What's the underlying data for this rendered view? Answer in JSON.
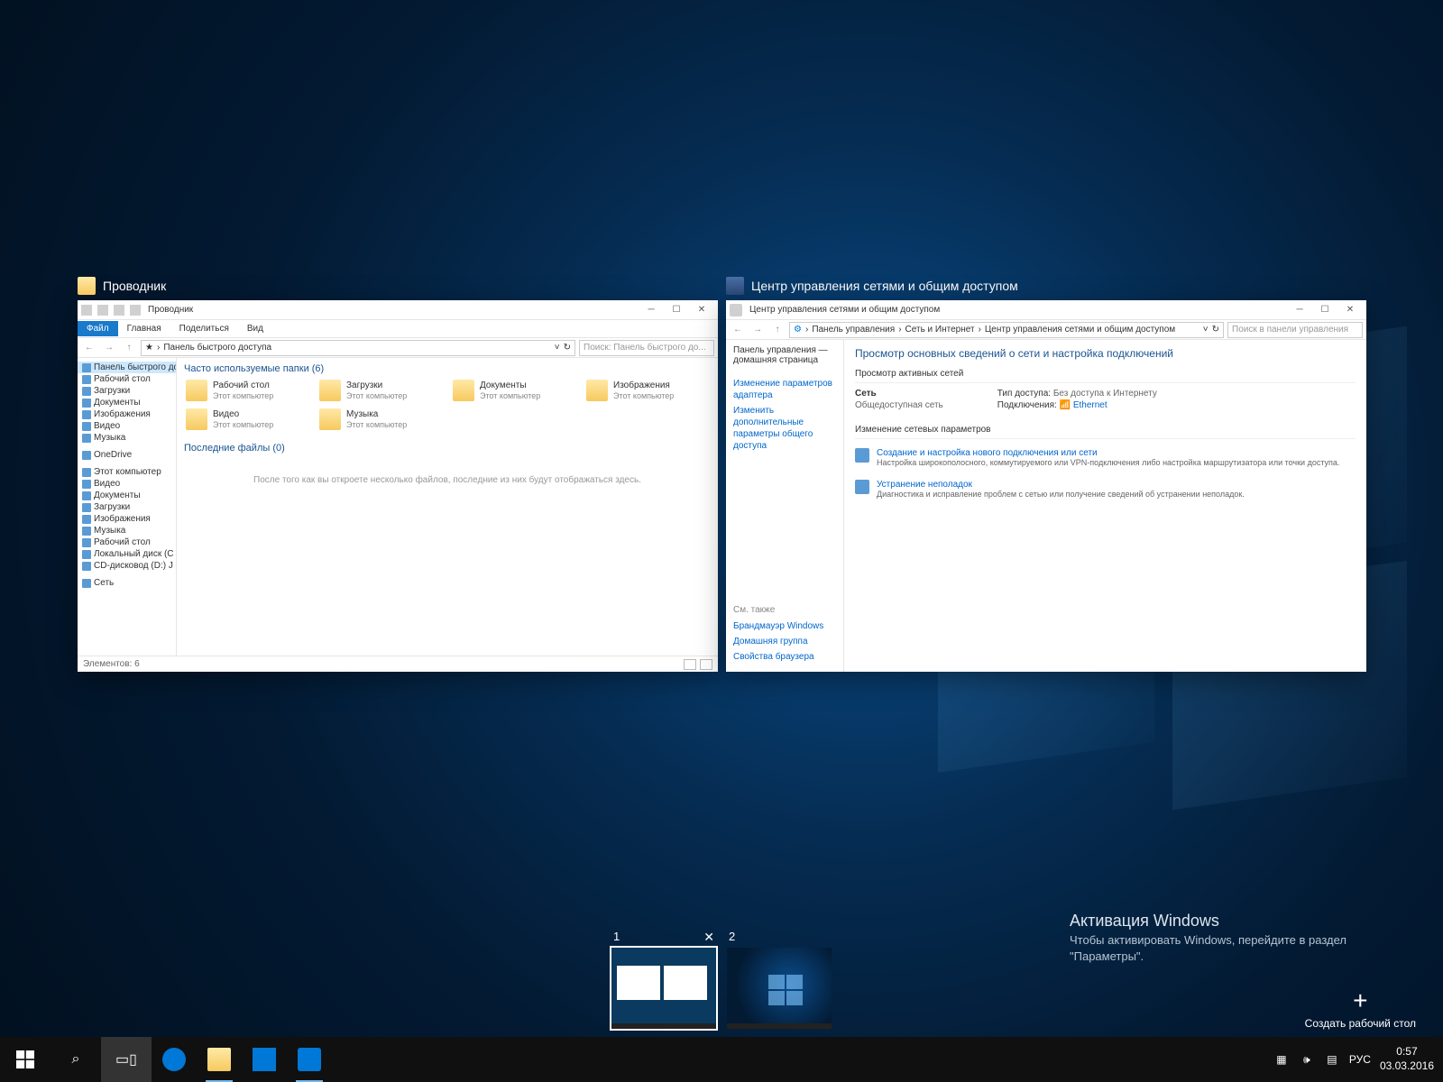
{
  "previews": {
    "explorer": {
      "title": "Проводник",
      "titlebar_title": "Проводник",
      "ribbon": {
        "file": "Файл",
        "home": "Главная",
        "share": "Поделиться",
        "view": "Вид"
      },
      "address": "Панель быстрого доступа",
      "search_placeholder": "Поиск: Панель быстрого до...",
      "sidebar": {
        "quick": "Панель быстрого дос",
        "items": [
          "Рабочий стол",
          "Загрузки",
          "Документы",
          "Изображения",
          "Видео",
          "Музыка"
        ],
        "onedrive": "OneDrive",
        "thispc": "Этот компьютер",
        "pc_items": [
          "Видео",
          "Документы",
          "Загрузки",
          "Изображения",
          "Музыка",
          "Рабочий стол",
          "Локальный диск (C",
          "CD-дисковод (D:) J"
        ],
        "network": "Сеть"
      },
      "main": {
        "freq_title": "Часто используемые папки (6)",
        "folders": [
          {
            "name": "Рабочий стол",
            "loc": "Этот компьютер"
          },
          {
            "name": "Загрузки",
            "loc": "Этот компьютер"
          },
          {
            "name": "Документы",
            "loc": "Этот компьютер"
          },
          {
            "name": "Изображения",
            "loc": "Этот компьютер"
          },
          {
            "name": "Видео",
            "loc": "Этот компьютер"
          },
          {
            "name": "Музыка",
            "loc": "Этот компьютер"
          }
        ],
        "recent_title": "Последние файлы (0)",
        "empty": "После того как вы откроете несколько файлов, последние из них будут отображаться здесь."
      },
      "status": "Элементов: 6"
    },
    "network": {
      "title": "Центр управления сетями и общим доступом",
      "titlebar_title": "Центр управления сетями и общим доступом",
      "breadcrumb": [
        "Панель управления",
        "Сеть и Интернет",
        "Центр управления сетями и общим доступом"
      ],
      "search_placeholder": "Поиск в панели управления",
      "side": {
        "home": "Панель управления — домашняя страница",
        "links": [
          "Изменение параметров адаптера",
          "Изменить дополнительные параметры общего доступа"
        ]
      },
      "h1": "Просмотр основных сведений о сети и настройка подключений",
      "active_title": "Просмотр активных сетей",
      "net_name": "Сеть",
      "net_type": "Общедоступная сеть",
      "access_lbl": "Тип доступа:",
      "access_val": "Без доступа к Интернету",
      "conn_lbl": "Подключения:",
      "conn_val": "Ethernet",
      "settings_title": "Изменение сетевых параметров",
      "task1_title": "Создание и настройка нового подключения или сети",
      "task1_desc": "Настройка широкополосного, коммутируемого или VPN-подключения либо настройка маршрутизатора или точки доступа.",
      "task2_title": "Устранение неполадок",
      "task2_desc": "Диагностика и исправление проблем с сетью или получение сведений об устранении неполадок.",
      "footer_title": "См. также",
      "footer_links": [
        "Брандмауэр Windows",
        "Домашняя группа",
        "Свойства браузера"
      ]
    }
  },
  "desktops": {
    "d1": "1",
    "d2": "2"
  },
  "new_desktop": "Создать рабочий стол",
  "watermark": {
    "title": "Активация Windows",
    "subtitle": "Чтобы активировать Windows, перейдите в раздел \"Параметры\"."
  },
  "taskbar": {
    "lang": "РУС",
    "time": "0:57",
    "date": "03.03.2016"
  }
}
